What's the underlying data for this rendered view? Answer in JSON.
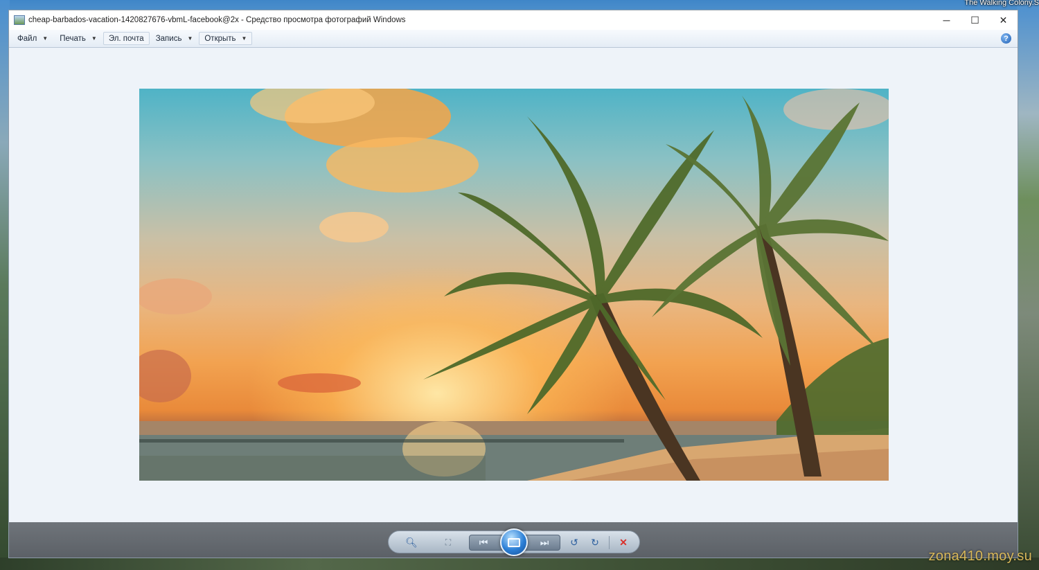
{
  "desktop": {
    "label": "The Walking   Colony.S",
    "watermark": "zona410.moy.su"
  },
  "window": {
    "title": "cheap-barbados-vacation-1420827676-vbmL-facebook@2x - Средство просмотра фотографий Windows",
    "controls": {
      "minimize": "─",
      "maximize": "☐",
      "close": "✕"
    }
  },
  "menu": {
    "items": [
      {
        "label": "Файл",
        "has_dropdown": true
      },
      {
        "label": "Печать",
        "has_dropdown": true
      },
      {
        "label": "Эл. почта",
        "has_dropdown": false
      },
      {
        "label": "Запись",
        "has_dropdown": true
      },
      {
        "label": "Открыть",
        "has_dropdown": true
      }
    ],
    "help_symbol": "?"
  },
  "image": {
    "description_icon": "photo",
    "subject": "tropical beach sunset with palm trees"
  },
  "controls": {
    "zoom_icon": "magnifier-icon",
    "actual_size_icon": "fit-window-icon",
    "previous_icon": "skip-previous-icon",
    "slideshow_icon": "slideshow-icon",
    "next_icon": "skip-next-icon",
    "rotate_left_icon": "rotate-ccw-icon",
    "rotate_right_icon": "rotate-cw-icon",
    "delete_icon": "delete-x-icon",
    "delete_color": "#d9302b",
    "accent_color": "#2b7fd6"
  }
}
